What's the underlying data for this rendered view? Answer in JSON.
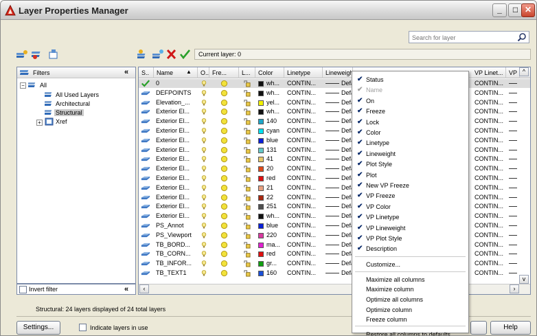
{
  "window": {
    "title": "Layer Properties Manager"
  },
  "search": {
    "placeholder": "Search for layer"
  },
  "current_layer": {
    "text": "Current layer: 0"
  },
  "filters": {
    "header": "Filters",
    "tree": [
      {
        "label": "All"
      },
      {
        "label": "All Used Layers"
      },
      {
        "label": "Architectural"
      },
      {
        "label": "Structural"
      },
      {
        "label": "Xref"
      }
    ],
    "invert_label": "Invert filter"
  },
  "grid": {
    "columns": [
      "S..",
      "Name",
      "O..",
      "Fre...",
      "L...",
      "Color",
      "Linetype",
      "Lineweight",
      "VP Linet...",
      "VP"
    ],
    "rows": [
      {
        "name": "0",
        "color_name": "wh...",
        "color": "#111111",
        "linetype": "CONTIN...",
        "lw": "Defa",
        "vp_linetype": "CONTIN..."
      },
      {
        "name": "DEFPOINTS",
        "color_name": "wh...",
        "color": "#111111",
        "linetype": "CONTIN...",
        "lw": "Defa",
        "vp_linetype": "CONTIN..."
      },
      {
        "name": "Elevation_...",
        "color_name": "yel...",
        "color": "#f2f200",
        "linetype": "CONTIN...",
        "lw": "Defa",
        "vp_linetype": "CONTIN..."
      },
      {
        "name": "Exterior El...",
        "color_name": "wh...",
        "color": "#111111",
        "linetype": "CONTIN...",
        "lw": "Defa",
        "vp_linetype": "CONTIN..."
      },
      {
        "name": "Exterior El...",
        "color_name": "140",
        "color": "#1ea6c8",
        "linetype": "CONTIN...",
        "lw": "Defa",
        "vp_linetype": "CONTIN..."
      },
      {
        "name": "Exterior El...",
        "color_name": "cyan",
        "color": "#00e0f0",
        "linetype": "CONTIN...",
        "lw": "Defa",
        "vp_linetype": "CONTIN..."
      },
      {
        "name": "Exterior El...",
        "color_name": "blue",
        "color": "#0a1fd8",
        "linetype": "CONTIN...",
        "lw": "Defa",
        "vp_linetype": "CONTIN..."
      },
      {
        "name": "Exterior El...",
        "color_name": "131",
        "color": "#66c8c8",
        "linetype": "CONTIN...",
        "lw": "Defa",
        "vp_linetype": "CONTIN..."
      },
      {
        "name": "Exterior El...",
        "color_name": "41",
        "color": "#e8c86a",
        "linetype": "CONTIN...",
        "lw": "Defa",
        "vp_linetype": "CONTIN..."
      },
      {
        "name": "Exterior El...",
        "color_name": "20",
        "color": "#e04a1a",
        "linetype": "CONTIN...",
        "lw": "Defa",
        "vp_linetype": "CONTIN..."
      },
      {
        "name": "Exterior El...",
        "color_name": "red",
        "color": "#e01010",
        "linetype": "CONTIN...",
        "lw": "Defa",
        "vp_linetype": "CONTIN..."
      },
      {
        "name": "Exterior El...",
        "color_name": "21",
        "color": "#e8a080",
        "linetype": "CONTIN...",
        "lw": "Defa",
        "vp_linetype": "CONTIN..."
      },
      {
        "name": "Exterior El...",
        "color_name": "22",
        "color": "#a82810",
        "linetype": "CONTIN...",
        "lw": "Defa",
        "vp_linetype": "CONTIN..."
      },
      {
        "name": "Exterior El...",
        "color_name": "251",
        "color": "#505050",
        "linetype": "CONTIN...",
        "lw": "Defa",
        "vp_linetype": "CONTIN..."
      },
      {
        "name": "Exterior El...",
        "color_name": "wh...",
        "color": "#111111",
        "linetype": "CONTIN...",
        "lw": "Defa",
        "vp_linetype": "CONTIN..."
      },
      {
        "name": "PS_Annot",
        "color_name": "blue",
        "color": "#0a1fd8",
        "linetype": "CONTIN...",
        "lw": "Defa",
        "vp_linetype": "CONTIN..."
      },
      {
        "name": "PS_Viewport",
        "color_name": "220",
        "color": "#d83aa0",
        "linetype": "CONTIN...",
        "lw": "Defa",
        "vp_linetype": "CONTIN..."
      },
      {
        "name": "TB_BORD...",
        "color_name": "ma...",
        "color": "#e020d0",
        "linetype": "CONTIN...",
        "lw": "Defa",
        "vp_linetype": "CONTIN..."
      },
      {
        "name": "TB_CORN...",
        "color_name": "red",
        "color": "#e01010",
        "linetype": "CONTIN...",
        "lw": "Defa",
        "vp_linetype": "CONTIN..."
      },
      {
        "name": "TB_INFOR...",
        "color_name": "gr...",
        "color": "#10a010",
        "linetype": "CONTIN...",
        "lw": "Defa",
        "vp_linetype": "CONTIN..."
      },
      {
        "name": "TB_TEXT1",
        "color_name": "160",
        "color": "#1a50d8",
        "linetype": "CONTIN...",
        "lw": "Defa",
        "vp_linetype": "CONTIN..."
      }
    ]
  },
  "context_menu": {
    "columns": [
      {
        "label": "Status",
        "checked": true,
        "disabled": false
      },
      {
        "label": "Name",
        "checked": true,
        "disabled": true
      },
      {
        "label": "On",
        "checked": true,
        "disabled": false
      },
      {
        "label": "Freeze",
        "checked": true,
        "disabled": false
      },
      {
        "label": "Lock",
        "checked": true,
        "disabled": false
      },
      {
        "label": "Color",
        "checked": true,
        "disabled": false
      },
      {
        "label": "Linetype",
        "checked": true,
        "disabled": false
      },
      {
        "label": "Lineweight",
        "checked": true,
        "disabled": false
      },
      {
        "label": "Plot Style",
        "checked": true,
        "disabled": false
      },
      {
        "label": "Plot",
        "checked": true,
        "disabled": false
      },
      {
        "label": "New VP Freeze",
        "checked": true,
        "disabled": false
      },
      {
        "label": "VP Freeze",
        "checked": true,
        "disabled": false
      },
      {
        "label": "VP Color",
        "checked": true,
        "disabled": false
      },
      {
        "label": "VP Linetype",
        "checked": true,
        "disabled": false
      },
      {
        "label": "VP Lineweight",
        "checked": true,
        "disabled": false
      },
      {
        "label": "VP Plot Style",
        "checked": true,
        "disabled": false
      },
      {
        "label": "Description",
        "checked": true,
        "disabled": false
      }
    ],
    "customize": "Customize...",
    "actions": [
      "Maximize all columns",
      "Maximize column",
      "Optimize all columns",
      "Optimize column",
      "Freeze column"
    ],
    "restore": "Restore all columns to defaults"
  },
  "status": {
    "text": "Structural: 24 layers displayed of 24 total layers"
  },
  "buttons": {
    "settings": "Settings...",
    "indicate": "Indicate layers in use",
    "help": "Help"
  }
}
